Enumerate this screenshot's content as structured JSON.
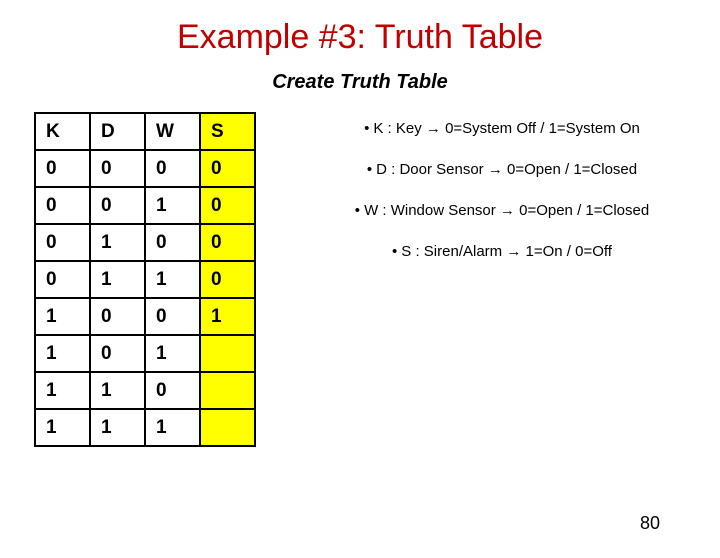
{
  "title": "Example #3: Truth Table",
  "subtitle": "Create Truth Table",
  "chart_data": {
    "type": "table",
    "columns": [
      "K",
      "D",
      "W",
      "S"
    ],
    "rows": [
      [
        "0",
        "0",
        "0",
        "0"
      ],
      [
        "0",
        "0",
        "1",
        "0"
      ],
      [
        "0",
        "1",
        "0",
        "0"
      ],
      [
        "0",
        "1",
        "1",
        "0"
      ],
      [
        "1",
        "0",
        "0",
        "1"
      ],
      [
        "1",
        "0",
        "1",
        ""
      ],
      [
        "1",
        "1",
        "0",
        ""
      ],
      [
        "1",
        "1",
        "1",
        ""
      ]
    ],
    "highlight_col": 3
  },
  "legend": [
    "K : Key → 0=System Off / 1=System On",
    "D : Door Sensor → 0=Open / 1=Closed",
    "W : Window Sensor → 0=Open / 1=Closed",
    "S : Siren/Alarm → 1=On / 0=Off"
  ],
  "page_number": "80"
}
